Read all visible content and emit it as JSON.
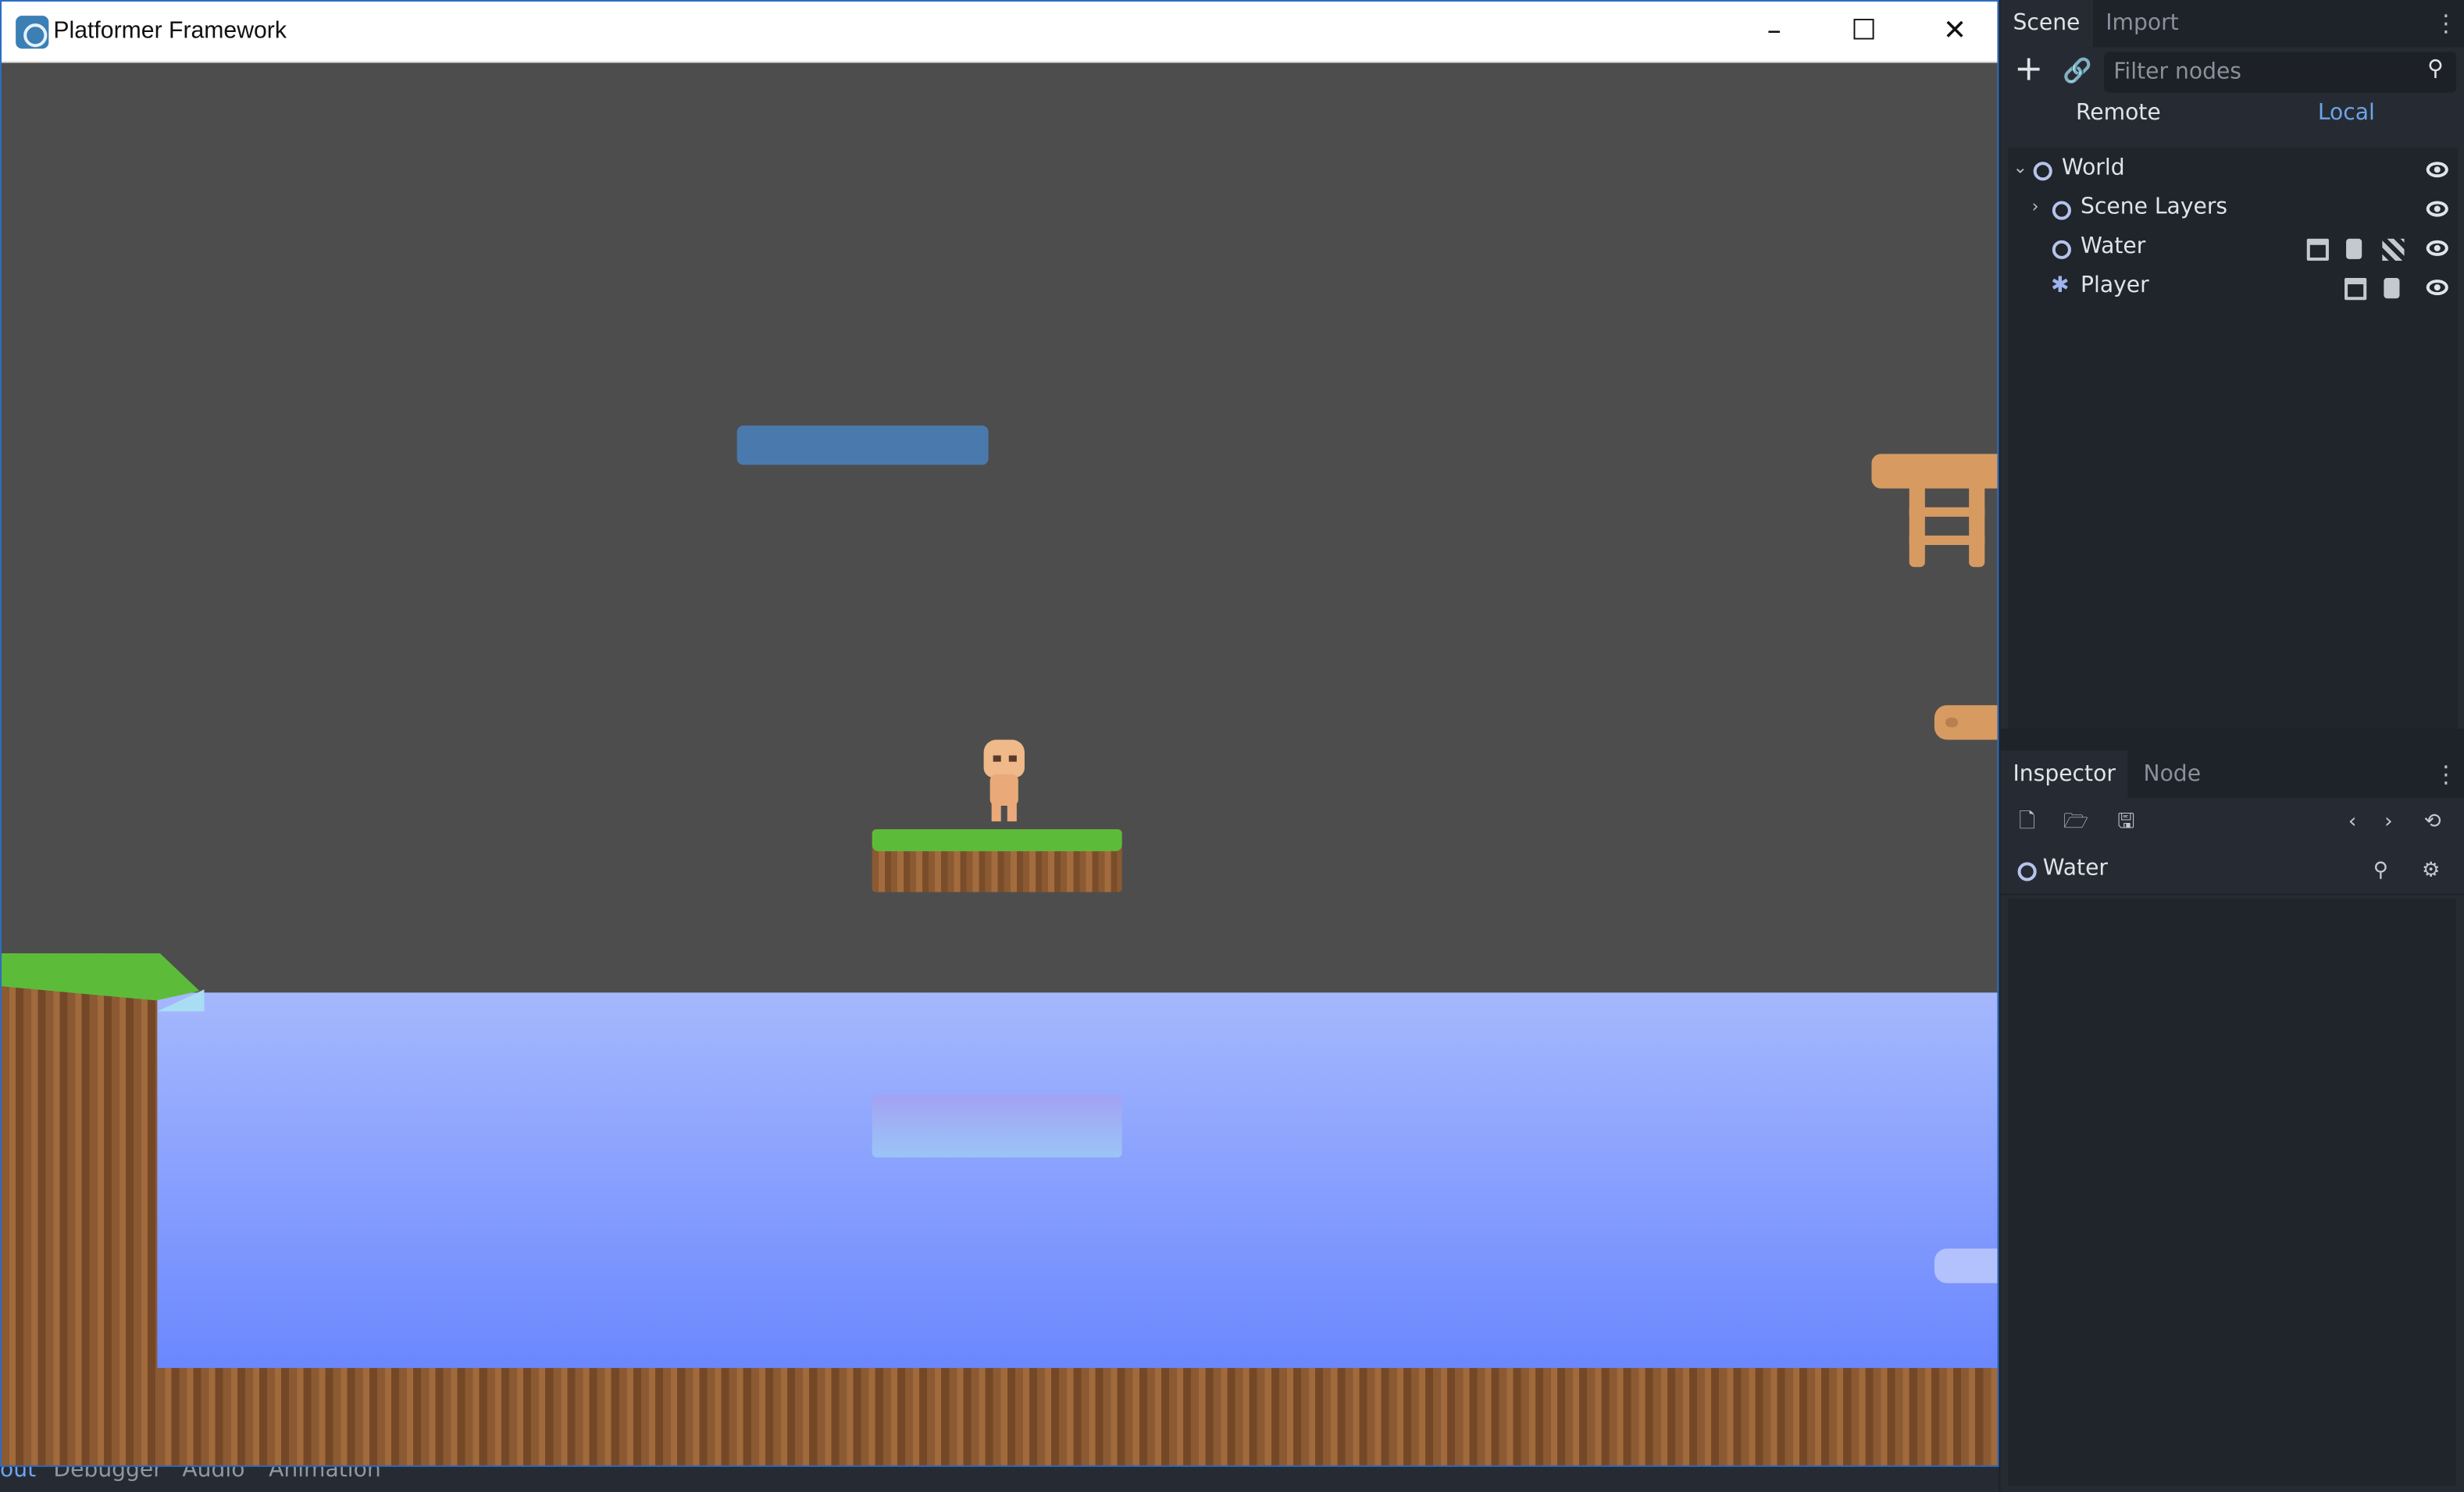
{
  "window": {
    "title": "Platformer Framework",
    "min_glyph": "–",
    "max_glyph": "☐",
    "close_glyph": "✕"
  },
  "bottom_tabs": [
    "out",
    "Debugger",
    "Audio",
    "Animation"
  ],
  "scene_dock": {
    "tabs": {
      "scene": "Scene",
      "import": "Import"
    },
    "filter_placeholder": "Filter nodes",
    "remote": "Remote",
    "local": "Local",
    "tree": [
      {
        "label": "World",
        "icon": "node-icon",
        "expanded": true
      },
      {
        "label": "Scene Layers",
        "icon": "node-icon",
        "expanded": false
      },
      {
        "label": "Water",
        "icon": "node-icon",
        "badges": [
          "clapperboard-icon",
          "script-icon",
          "texture-icon"
        ]
      },
      {
        "label": "Player",
        "icon": "kinematic-body-icon",
        "badges": [
          "clapperboard-icon",
          "script-icon"
        ]
      }
    ]
  },
  "inspector_dock": {
    "tabs": {
      "inspector": "Inspector",
      "node": "Node"
    },
    "selected_object": "Water"
  },
  "colors": {
    "accent": "#6ca4ea",
    "panel_bg": "#262b33",
    "viewport_bg": "#4d4d4d",
    "water_top": "#a5b8fd",
    "water_bottom": "#6b87fe"
  }
}
